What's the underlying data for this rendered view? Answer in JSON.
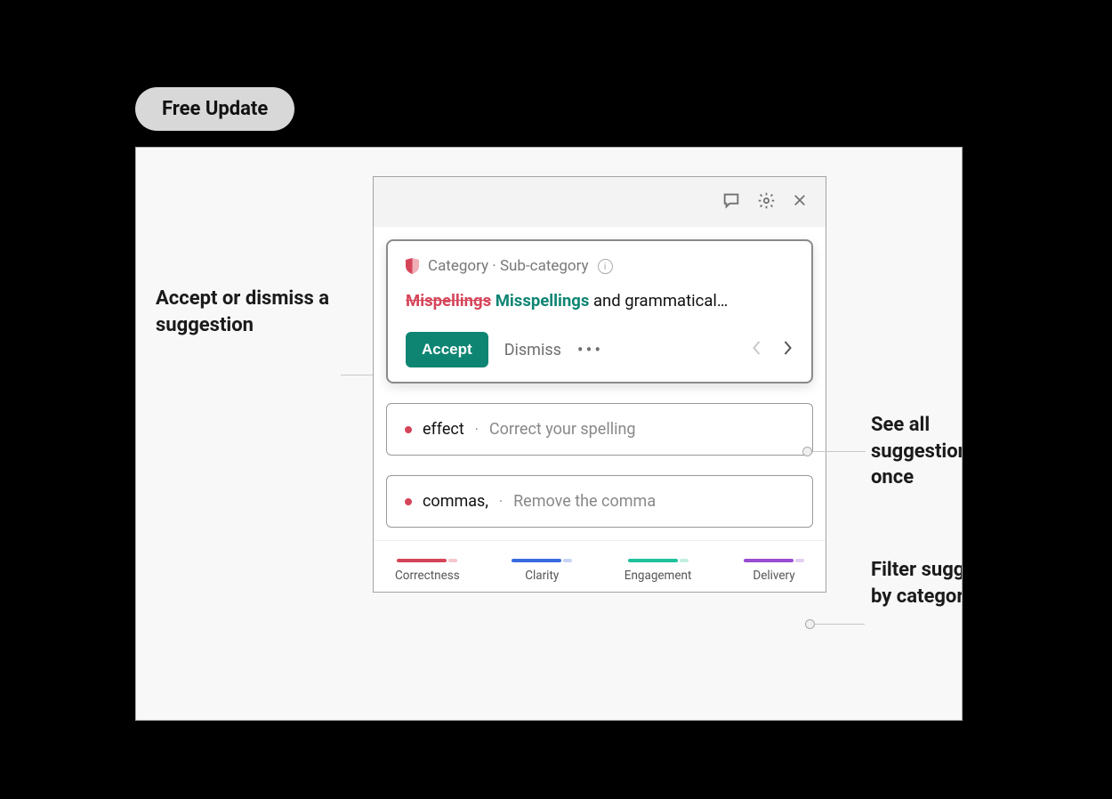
{
  "badge": "Free Update",
  "callouts": {
    "left": "Accept or dismiss a suggestion",
    "right1": "See all suggestions at once",
    "right2": "Filter suggestions by category"
  },
  "header_icons": {
    "feedback": "feedback-icon",
    "settings": "gear-icon",
    "close": "close-icon"
  },
  "expanded": {
    "category_label": "Category · Sub-category",
    "strike_word": "Mispellings",
    "correct_word": "Misspellings",
    "tail_text": " and grammatical…",
    "accept": "Accept",
    "dismiss": "Dismiss",
    "more": "•••"
  },
  "items": [
    {
      "word": "effect",
      "hint": "Correct your spelling"
    },
    {
      "word": "commas,",
      "hint": "Remove the comma"
    }
  ],
  "filters": [
    {
      "label": "Correctness",
      "color": "#d5455a",
      "tail": "#f6c7cd"
    },
    {
      "label": "Clarity",
      "color": "#3a6ae0",
      "tail": "#c7d3f4"
    },
    {
      "label": "Engagement",
      "color": "#1ec29b",
      "tail": "#c2eee2"
    },
    {
      "label": "Delivery",
      "color": "#9a4dd0",
      "tail": "#e3cff2"
    }
  ]
}
